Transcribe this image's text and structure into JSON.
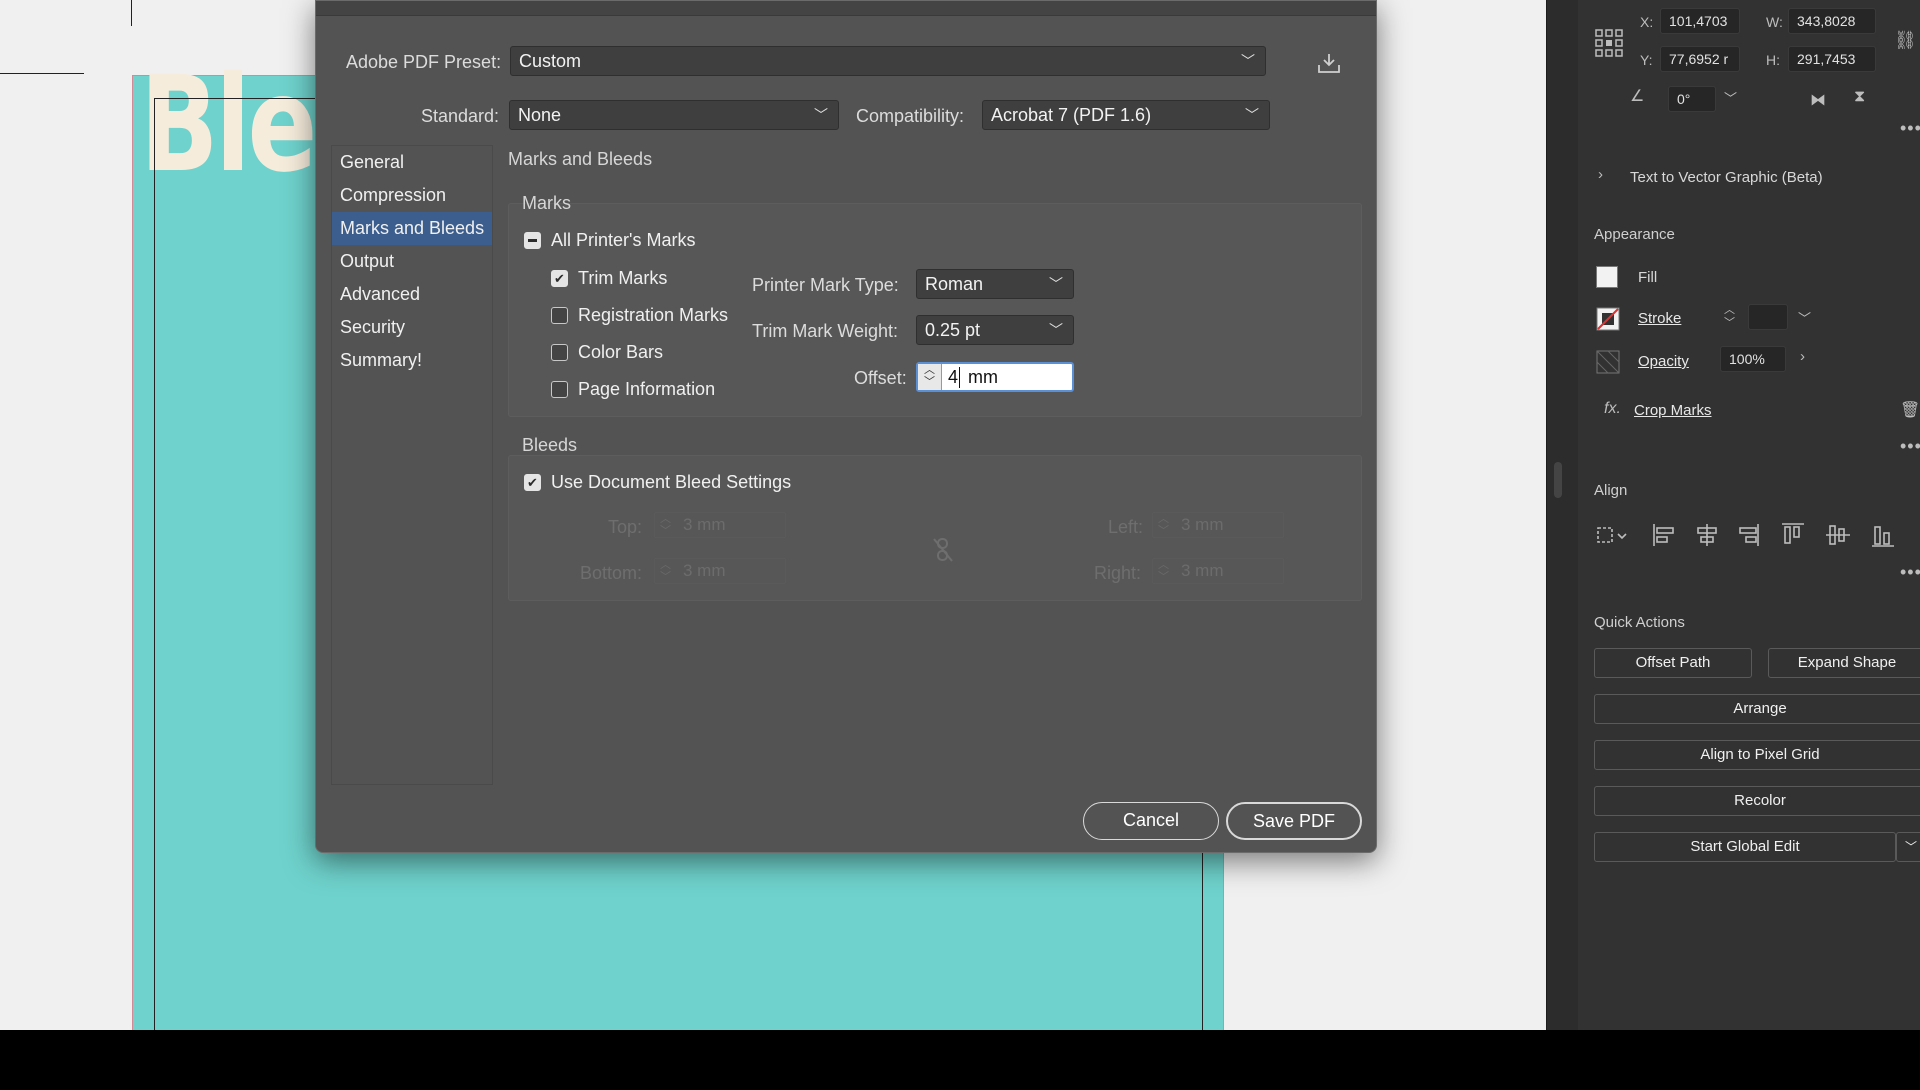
{
  "canvas": {
    "artboard_text": "Blee"
  },
  "dialog": {
    "preset_label": "Adobe PDF Preset:",
    "preset_value": "Custom",
    "standard_label": "Standard:",
    "standard_value": "None",
    "compatibility_label": "Compatibility:",
    "compatibility_value": "Acrobat 7 (PDF 1.6)",
    "nav": [
      "General",
      "Compression",
      "Marks and Bleeds",
      "Output",
      "Advanced",
      "Security",
      "Summary!"
    ],
    "active_nav": "Marks and Bleeds",
    "section_title": "Marks and Bleeds",
    "marks": {
      "title": "Marks",
      "all_printers_marks": "All Printer's Marks",
      "trim_marks": "Trim Marks",
      "registration_marks": "Registration Marks",
      "color_bars": "Color Bars",
      "page_information": "Page Information",
      "printer_mark_type_label": "Printer Mark Type:",
      "printer_mark_type_value": "Roman",
      "trim_mark_weight_label": "Trim Mark Weight:",
      "trim_mark_weight_value": "0.25 pt",
      "offset_label": "Offset:",
      "offset_value": "4",
      "offset_unit": "mm"
    },
    "bleeds": {
      "title": "Bleeds",
      "use_document_bleed": "Use Document Bleed Settings",
      "top_label": "Top:",
      "bottom_label": "Bottom:",
      "left_label": "Left:",
      "right_label": "Right:",
      "top_value": "3 mm",
      "bottom_value": "3 mm",
      "left_value": "3 mm",
      "right_value": "3 mm"
    },
    "cancel_label": "Cancel",
    "save_label": "Save PDF"
  },
  "panel": {
    "x_label": "X:",
    "x_value": "101,4703",
    "y_label": "Y:",
    "y_value": "77,6952 r",
    "w_label": "W:",
    "w_value": "343,8028",
    "h_label": "H:",
    "h_value": "291,7453",
    "angle_value": "0°",
    "text_to_vector": "Text to Vector Graphic (Beta)",
    "appearance_title": "Appearance",
    "fill_label": "Fill",
    "stroke_label": "Stroke",
    "opacity_label": "Opacity",
    "opacity_value": "100%",
    "effect_label": "Crop Marks",
    "align_title": "Align",
    "quick_actions_title": "Quick Actions",
    "offset_path": "Offset Path",
    "expand_shape": "Expand Shape",
    "arrange": "Arrange",
    "align_pixel_grid": "Align to Pixel Grid",
    "recolor": "Recolor",
    "start_global_edit": "Start Global Edit"
  }
}
